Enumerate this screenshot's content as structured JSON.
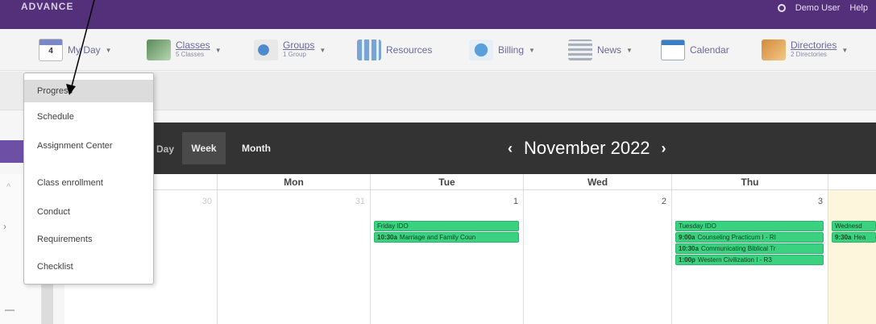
{
  "header": {
    "logo_text": "ADVANCE",
    "search_label": "Q",
    "user_name": "Demo User",
    "help_label": "Help"
  },
  "nav": {
    "my_day": {
      "label": "My Day",
      "date_num": "4"
    },
    "classes": {
      "label": "Classes",
      "sub": "5 Classes"
    },
    "groups": {
      "label": "Groups",
      "sub": "1 Group"
    },
    "resources": {
      "label": "Resources"
    },
    "billing": {
      "label": "Billing"
    },
    "news": {
      "label": "News"
    },
    "calendar": {
      "label": "Calendar"
    },
    "directories": {
      "label": "Directories",
      "sub": "2 Directories"
    }
  },
  "menu": {
    "items": [
      {
        "label": "Progress"
      },
      {
        "label": "Schedule"
      },
      {
        "label": "Assignment Center"
      },
      {
        "label": "Class enrollment"
      },
      {
        "label": "Conduct"
      },
      {
        "label": "Requirements"
      },
      {
        "label": "Checklist"
      }
    ]
  },
  "calendar": {
    "views": {
      "day": "Day",
      "week": "Week",
      "month": "Month"
    },
    "active_view": "Week",
    "title": "November 2022",
    "prev_icon": "chevron-left-icon",
    "next_icon": "chevron-right-icon",
    "days": [
      {
        "name": "",
        "num": "30",
        "muted": true
      },
      {
        "name": "Mon",
        "num": "31",
        "muted": true
      },
      {
        "name": "Tue",
        "num": "1",
        "muted": false
      },
      {
        "name": "Wed",
        "num": "2",
        "muted": false
      },
      {
        "name": "Thu",
        "num": "3",
        "muted": false
      },
      {
        "name": "",
        "num": "",
        "muted": false
      }
    ],
    "events": {
      "tue": [
        {
          "time": "",
          "title": "Friday IDO"
        },
        {
          "time": "10:30a",
          "title": "Marriage and Family Coun"
        }
      ],
      "thu": [
        {
          "time": "",
          "title": "Tuesday IDO"
        },
        {
          "time": "9:00a",
          "title": "Counseling Practicum I - RI"
        },
        {
          "time": "10:30a",
          "title": "Communicating Biblical Tr"
        },
        {
          "time": "1:00p",
          "title": "Western Civilization I - R3"
        }
      ],
      "fri": [
        {
          "time": "",
          "title": "Wednesd"
        },
        {
          "time": "9:30a",
          "title": "Hea"
        }
      ]
    }
  },
  "colors": {
    "brand_purple": "#54307a",
    "event_green": "#3ad180",
    "calendar_bar": "#333333"
  }
}
